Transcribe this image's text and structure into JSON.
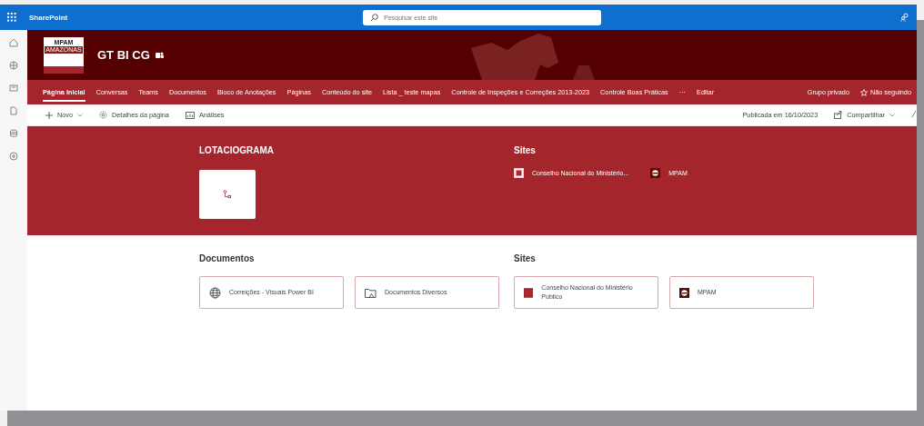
{
  "top_bar": {
    "app_name": "SharePoint",
    "search": {
      "placeholder": "Pesquisar este site"
    }
  },
  "site_header": {
    "title": "GT BI CG",
    "logo": {
      "name": "MPAM",
      "region": "AMAZONAS"
    }
  },
  "nav": {
    "items": [
      {
        "label": "Página Inicial",
        "selected": true
      },
      {
        "label": "Conversas",
        "selected": false
      },
      {
        "label": "Teams",
        "selected": false
      },
      {
        "label": "Documentos",
        "selected": false
      },
      {
        "label": "Bloco de Anotações",
        "selected": false
      },
      {
        "label": "Páginas",
        "selected": false
      },
      {
        "label": "Conteúdo do site",
        "selected": false
      },
      {
        "label": "Lista _ teste mapas",
        "selected": false
      },
      {
        "label": "Controle de Inspeções e Correções 2013-2023",
        "selected": false
      },
      {
        "label": "Controle Boas Práticas",
        "selected": false
      }
    ],
    "more": "···",
    "edit": "Editar",
    "privacy": "Grupo privado",
    "follow": "Não seguindo"
  },
  "command_bar": {
    "new": "Novo",
    "details": "Detalhes da página",
    "analytics": "Análises",
    "published": "Publicada em 16/10/2023",
    "share": "Compartilhar"
  },
  "hero": {
    "sections": [
      {
        "kind": "tile",
        "title": "LOTACIOGRAMA"
      },
      {
        "kind": "links",
        "title": "Sites",
        "items": [
          {
            "kind": "cnmp",
            "label": "Conselho Nacional do Ministério..."
          },
          {
            "kind": "mpam",
            "label": "MPAM"
          }
        ]
      }
    ]
  },
  "content": {
    "sections": [
      {
        "title": "Documentos",
        "cards": [
          {
            "kind": "globe",
            "label": "Correições - Visuais Power BI"
          },
          {
            "kind": "folder",
            "label": "Documentos Diversos"
          }
        ]
      },
      {
        "title": "Sites",
        "cards": [
          {
            "kind": "cnmp",
            "label": "Conselho Nacional do Ministério Público"
          },
          {
            "kind": "mpam",
            "label": "MPAM"
          }
        ]
      }
    ]
  }
}
